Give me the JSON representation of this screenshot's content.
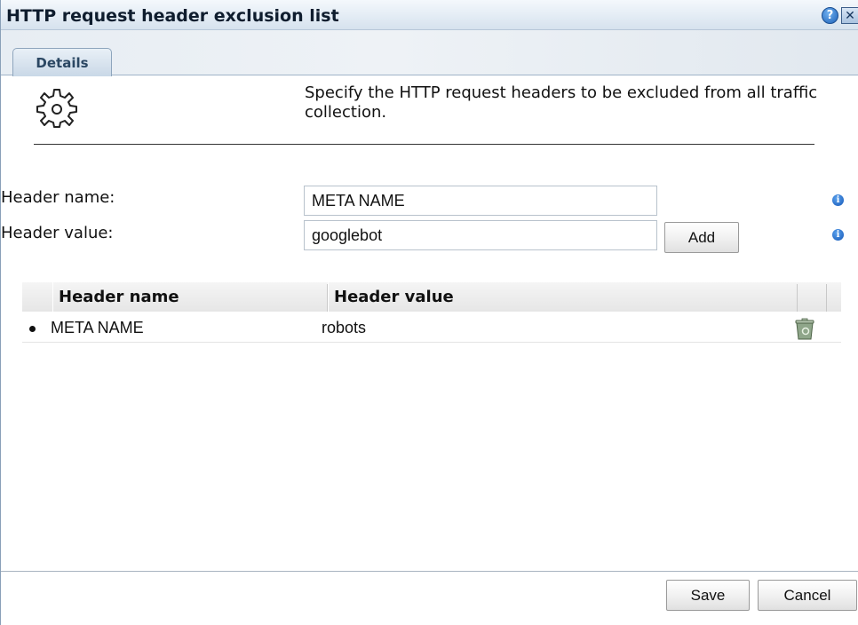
{
  "dialog": {
    "title": "HTTP request header exclusion list",
    "help_icon": "help-icon",
    "close_icon": "close-icon"
  },
  "tabs": [
    {
      "label": "Details",
      "active": true
    }
  ],
  "intro": {
    "icon": "gear-icon",
    "description": "Specify the HTTP request headers to be excluded from all traffic collection."
  },
  "form": {
    "header_name_label": "Header name:",
    "header_name_value": "META NAME",
    "header_value_label": "Header value:",
    "header_value_value": "googlebot",
    "add_label": "Add",
    "info_icon": "info-icon"
  },
  "table": {
    "columns": [
      "Header name",
      "Header value"
    ],
    "rows": [
      {
        "name": "META NAME",
        "value": "robots",
        "delete_icon": "trash-icon"
      }
    ]
  },
  "footer": {
    "save_label": "Save",
    "cancel_label": "Cancel"
  },
  "colors": {
    "title_bg": "#e2ebf4",
    "info_blue": "#1557b6",
    "trash_green": "#6e8a68"
  }
}
